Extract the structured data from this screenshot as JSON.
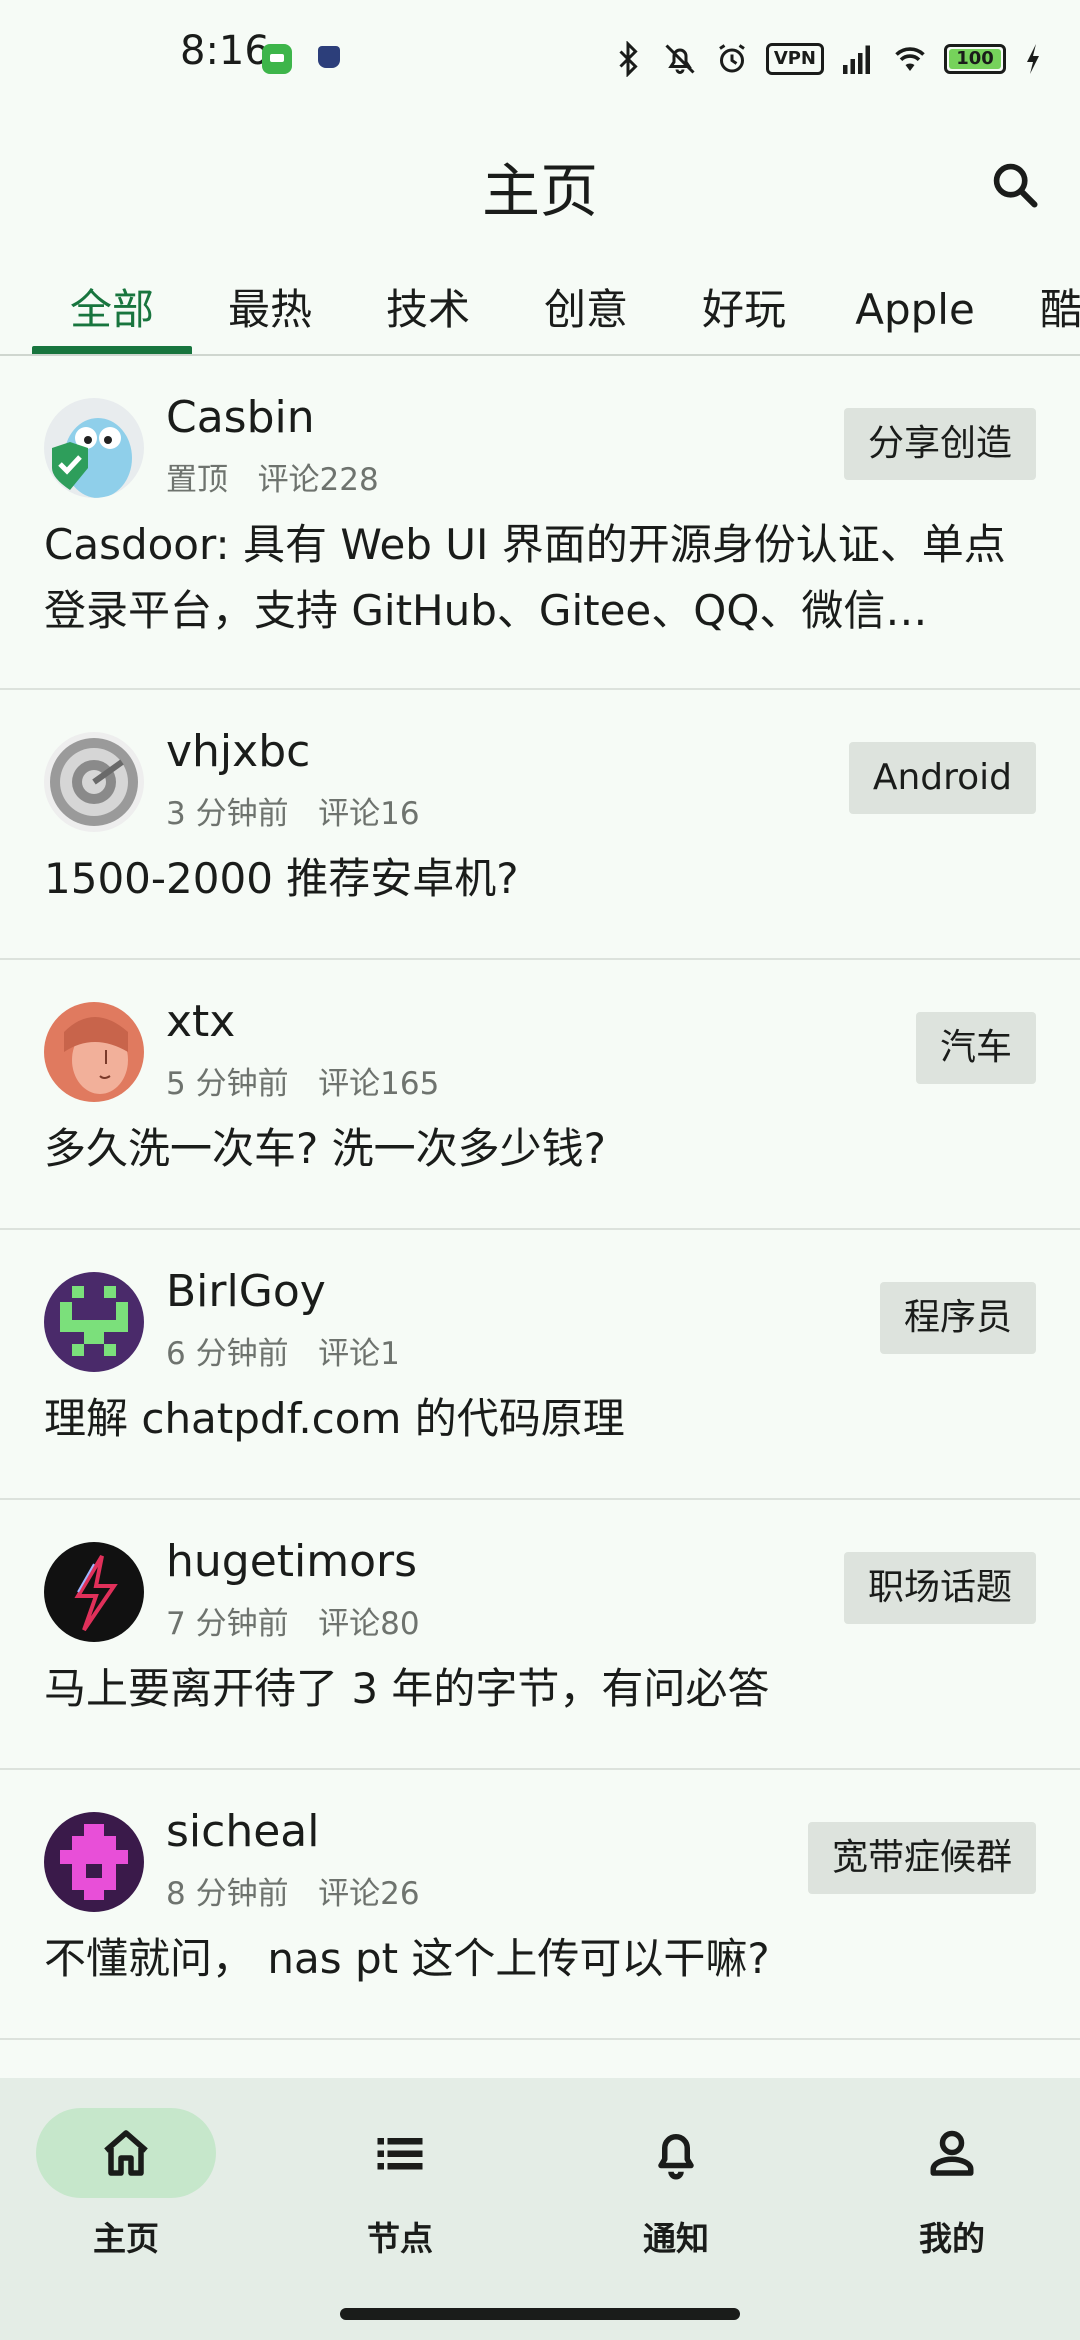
{
  "status_bar": {
    "time": "8:16",
    "vpn": "VPN",
    "battery": "100"
  },
  "header": {
    "title": "主页"
  },
  "tabs": [
    "全部",
    "最热",
    "技术",
    "创意",
    "好玩",
    "Apple",
    "酷"
  ],
  "active_tab": "全部",
  "posts": [
    {
      "user": "Casbin",
      "meta_left": "置顶",
      "meta_right": "评论228",
      "tag": "分享创造",
      "title": "Casdoor: 具有 Web UI 界面的开源身份认证、单点登录平台，支持 GitHub、Gitee、QQ、微信…"
    },
    {
      "user": "vhjxbc",
      "meta_left": "3 分钟前",
      "meta_right": "评论16",
      "tag": "Android",
      "title": "1500-2000 推荐安卓机?"
    },
    {
      "user": "xtx",
      "meta_left": "5 分钟前",
      "meta_right": "评论165",
      "tag": "汽车",
      "title": "多久洗一次车? 洗一次多少钱?"
    },
    {
      "user": "BirlGoy",
      "meta_left": "6 分钟前",
      "meta_right": "评论1",
      "tag": "程序员",
      "title": "理解 chatpdf.com 的代码原理"
    },
    {
      "user": "hugetimors",
      "meta_left": "7 分钟前",
      "meta_right": "评论80",
      "tag": "职场话题",
      "title": "马上要离开待了 3 年的字节，有问必答"
    },
    {
      "user": "sicheal",
      "meta_left": "8 分钟前",
      "meta_right": "评论26",
      "tag": "宽带症候群",
      "title": "不懂就问， nas pt 这个上传可以干嘛?"
    }
  ],
  "bottom_nav": [
    {
      "label": "主页",
      "icon": "home-icon"
    },
    {
      "label": "节点",
      "icon": "list-icon"
    },
    {
      "label": "通知",
      "icon": "bell-icon"
    },
    {
      "label": "我的",
      "icon": "person-icon"
    }
  ],
  "colors": {
    "accent": "#18753E",
    "background": "#F6FBF6",
    "tag_bg": "#DDE3DD",
    "nav_bg": "#E4EDE6",
    "nav_pill": "#C6E7CB"
  }
}
